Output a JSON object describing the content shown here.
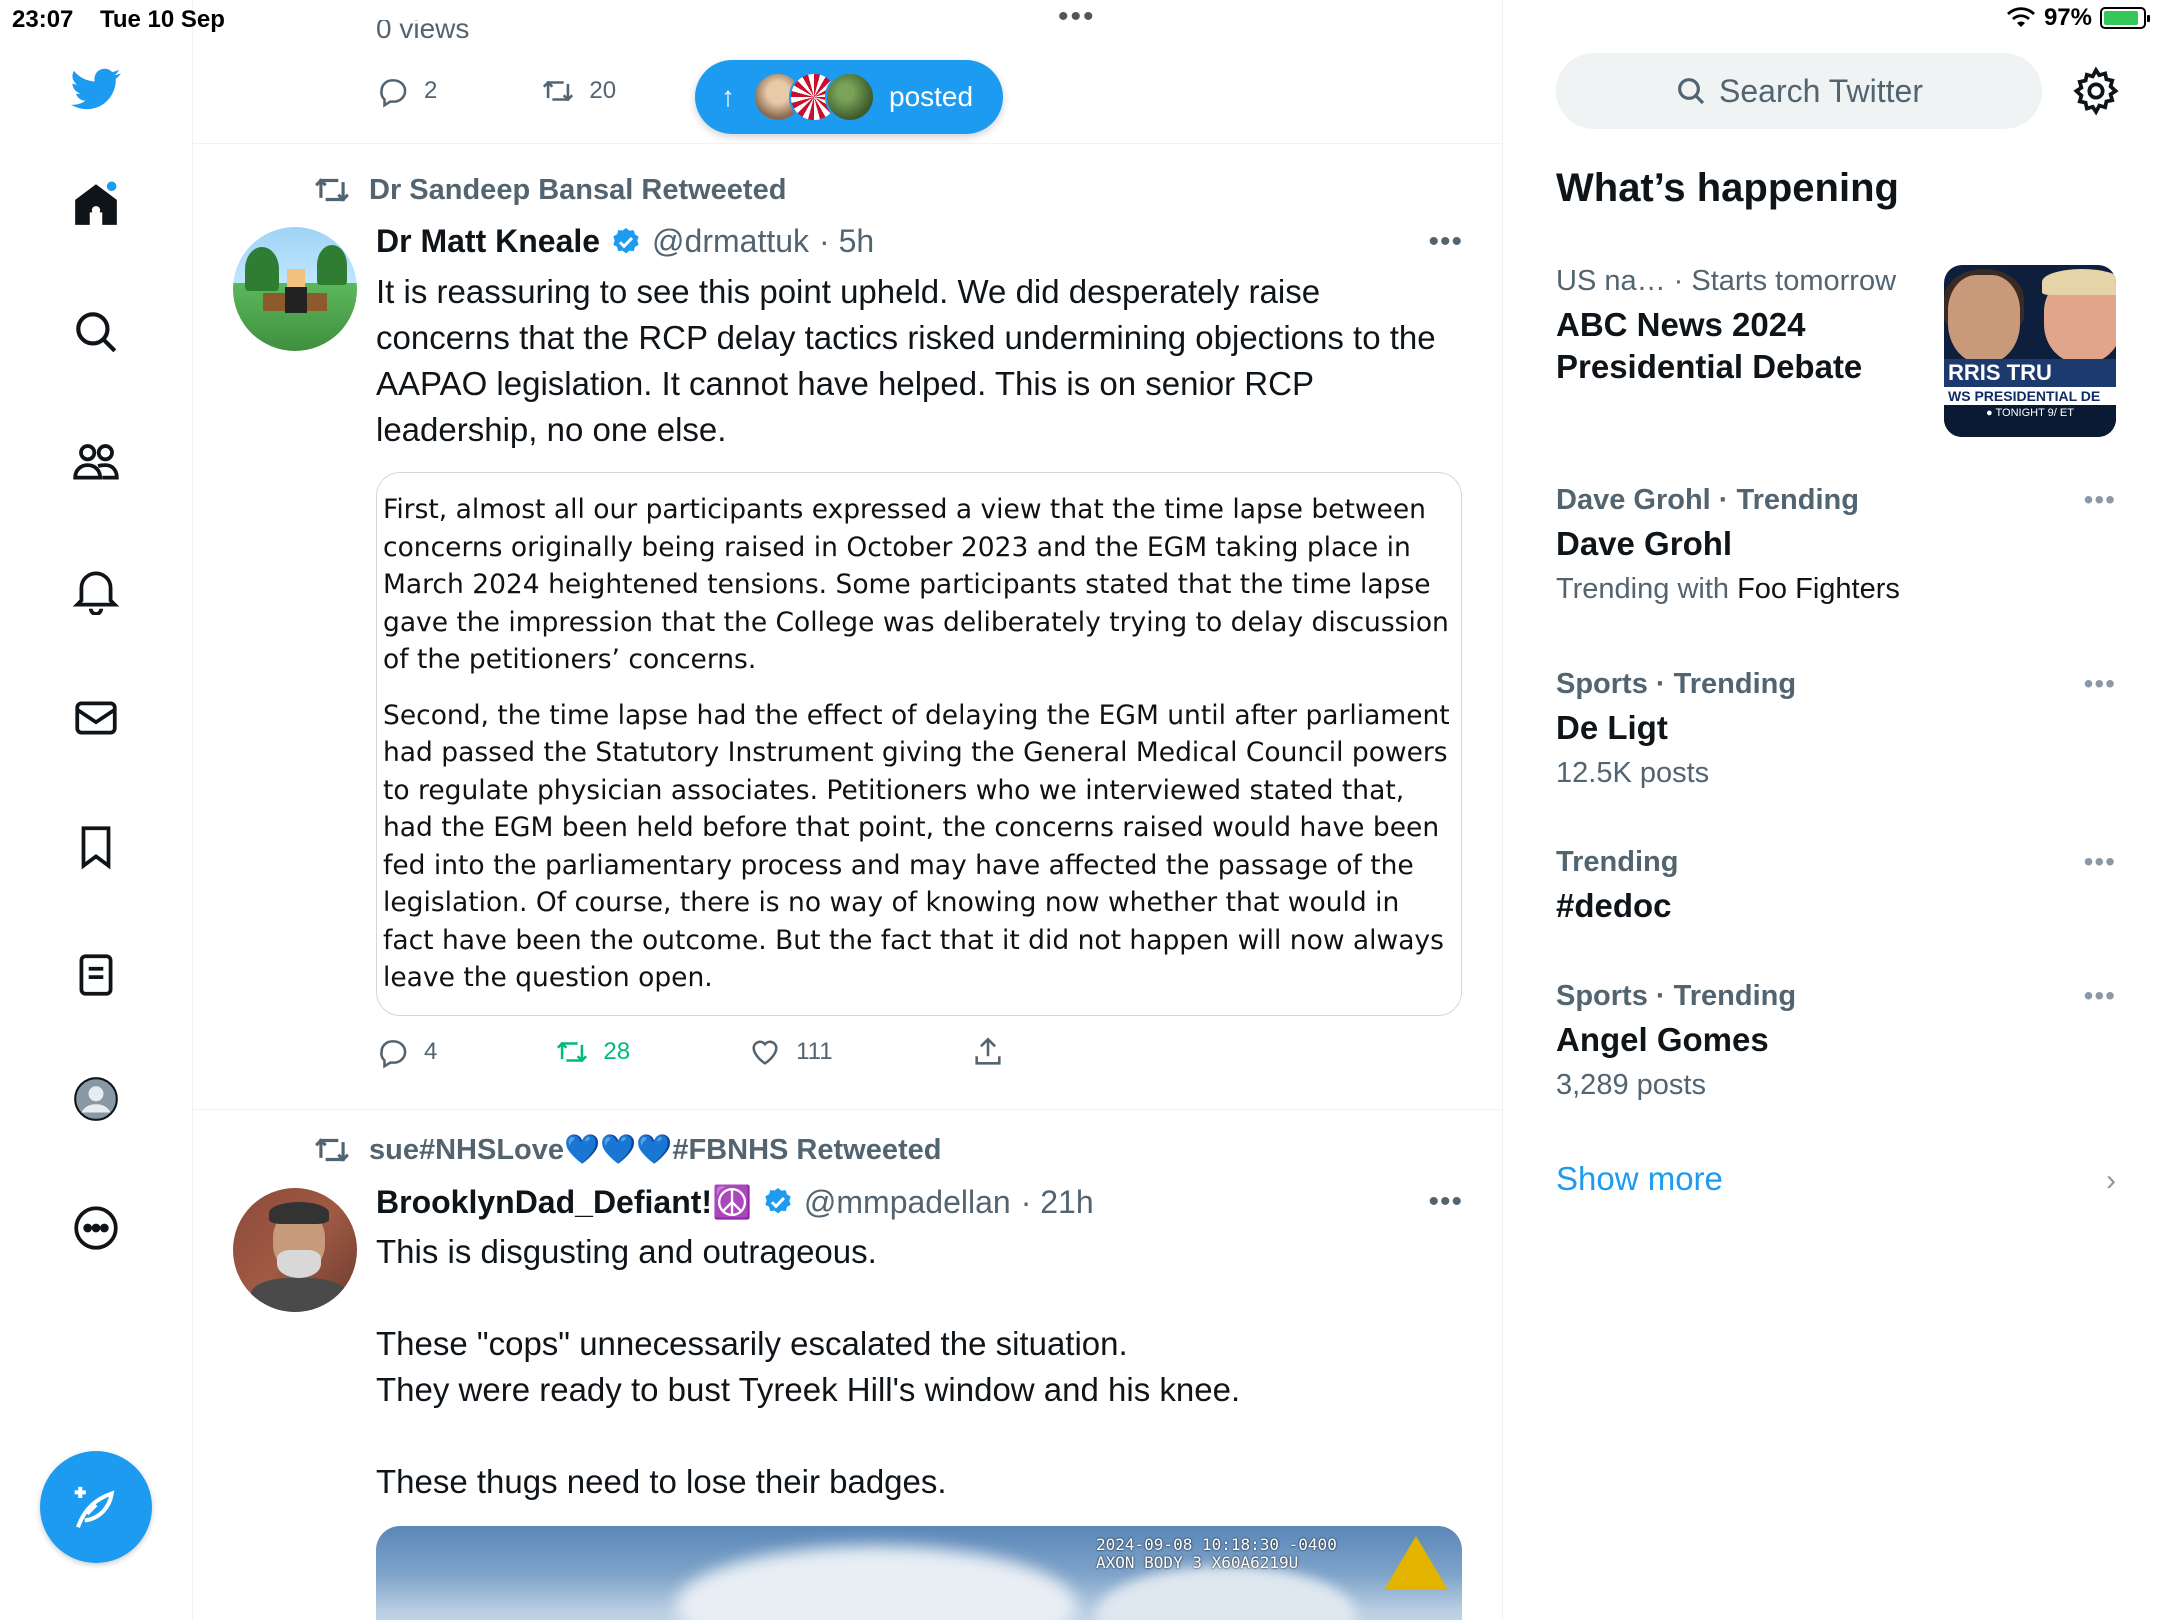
{
  "status_bar": {
    "time": "23:07",
    "date": "Tue 10 Sep",
    "battery": "97%"
  },
  "top_actions": {
    "views": "0 views",
    "replies": "2",
    "retweets": "20",
    "posted_label": "posted"
  },
  "tweets": [
    {
      "retweeted_by": "Dr Sandeep Bansal Retweeted",
      "name": "Dr Matt Kneale",
      "handle": "@drmattuk",
      "time": "· 5h",
      "text": "It is reassuring to see this point upheld. We did desperately raise concerns that the RCP delay tactics risked undermining objections to the AAPAO legislation. It cannot have helped. This is on senior RCP leadership, no one else.",
      "quote_paragraphs": [
        "First, almost all our participants expressed a view that the time lapse between concerns originally being raised in October 2023 and the EGM taking place in March 2024 heightened tensions. Some participants stated that the time lapse gave the impression that the College was deliberately trying to delay discussion of the petitioners’ concerns.",
        "Second, the time lapse had the effect of delaying the EGM until after parliament had passed the Statutory Instrument giving the General Medical Council powers to regulate physician associates. Petitioners who we interviewed stated that, had the EGM been held before that point, the concerns raised would have been fed into the parliamentary process and may have affected the passage of the legislation. Of course, there is no way of knowing now whether that would in fact have been the outcome. But the fact that it did not happen will now always leave the question open."
      ],
      "replies": "4",
      "retweets": "28",
      "likes": "111"
    },
    {
      "retweeted_by": "sue#NHSLove💙💙💙#FBNHS Retweeted",
      "name": "BrooklynDad_Defiant!☮️",
      "handle": "@mmpadellan",
      "time": "· 21h",
      "text": "This is disgusting and outrageous.\n\nThese \"cops\" unnecessarily escalated the situation.\nThey were ready to bust Tyreek Hill's window and his knee.\n\nThese thugs need to lose their badges.",
      "media_stamp": "2024-09-08 10:18:30 -0400\nAXON BODY 3 X60A6219U"
    }
  ],
  "sidebar": {
    "search_placeholder": "Search Twitter",
    "whats_happening": "What’s happening",
    "trends": [
      {
        "meta": "US na… · Starts tomorrow",
        "title": "ABC News 2024 Presidential Debate",
        "sub": "",
        "sub_dark": "",
        "image_text": {
          "band": "RRIS   TRU",
          "band2": "WS PRESIDENTIAL DE",
          "band3": "● TONIGHT 9/ ET"
        }
      },
      {
        "meta": "Dave Grohl · Trending",
        "title": "Dave Grohl",
        "sub": "Trending with ",
        "sub_dark": "Foo Fighters"
      },
      {
        "meta": "Sports · Trending",
        "title": "De Ligt",
        "sub": "12.5K posts",
        "sub_dark": ""
      },
      {
        "meta": "Trending",
        "title": "#dedoc",
        "sub": "",
        "sub_dark": ""
      },
      {
        "meta": "Sports · Trending",
        "title": "Angel Gomes",
        "sub": "3,289 posts",
        "sub_dark": ""
      }
    ],
    "show_more": "Show more"
  },
  "colors": {
    "accent": "#1d9bf0",
    "retweet_green": "#00ba7c",
    "muted": "#536471"
  }
}
